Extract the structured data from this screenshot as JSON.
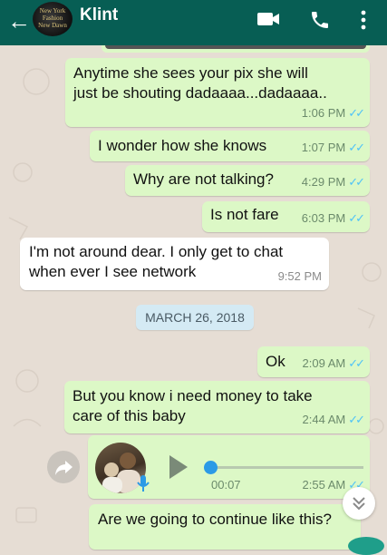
{
  "header": {
    "back_icon": "arrow-left-icon",
    "contact_name": "Klint",
    "avatar_text": [
      "New York",
      "Fashion",
      "New Dawn"
    ],
    "video_icon": "video-call-icon",
    "call_icon": "phone-call-icon",
    "menu_icon": "more-vertical-icon",
    "color": "#075e54"
  },
  "messages": [
    {
      "direction": "out",
      "text_line1": "Anytime she sees your pix she will",
      "text_line2": "just be shouting dadaaaa...dadaaaa..",
      "time": "1:06 PM",
      "ticks": "✓✓"
    },
    {
      "direction": "out",
      "text": "I wonder how she knows",
      "time": "1:07 PM",
      "ticks": "✓✓"
    },
    {
      "direction": "out",
      "text": "Why are not talking?",
      "time": "4:29 PM",
      "ticks": "✓✓"
    },
    {
      "direction": "out",
      "text": "Is not fare",
      "time": "6:03 PM",
      "ticks": "✓✓"
    },
    {
      "direction": "in",
      "text_line1": "I'm not around dear. I only get to chat",
      "text_line2": "when ever I see network",
      "time": "9:52 PM"
    },
    {
      "direction": "out",
      "text": "Ok",
      "time": "2:09 AM",
      "ticks": "✓✓"
    },
    {
      "direction": "out",
      "text_line1": "But you know i need money to take",
      "text_line2": "care of this baby",
      "time": "2:44 AM",
      "ticks": "✓✓"
    },
    {
      "direction": "out",
      "type": "voice",
      "duration": "00:07",
      "time": "2:55 AM",
      "ticks": "✓✓",
      "progress": 0
    },
    {
      "direction": "out",
      "text": "Are we going to continue like this?"
    }
  ],
  "date_separator": "MARCH 26, 2018",
  "colors": {
    "outgoing_bubble": "#dcf8c6",
    "incoming_bubble": "#ffffff",
    "read_ticks": "#4fc3f7",
    "chat_background": "#e6ddd4"
  }
}
